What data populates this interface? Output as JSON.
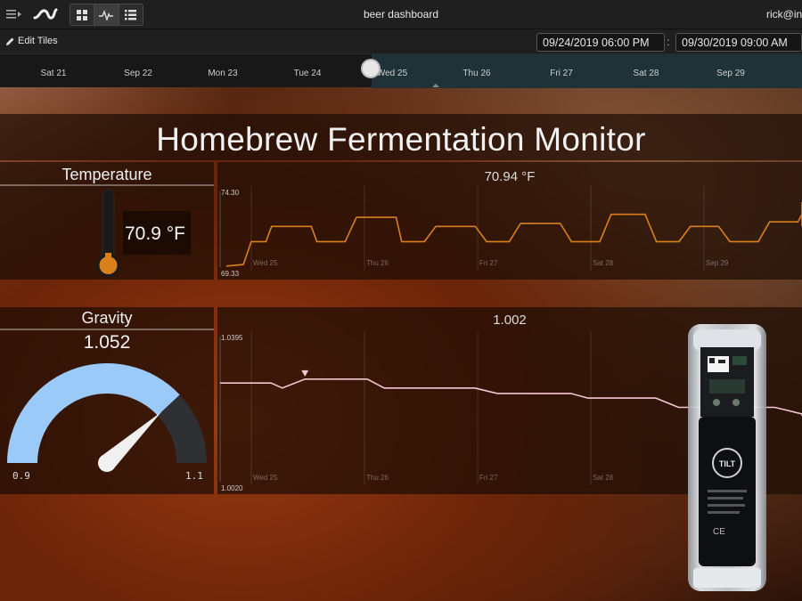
{
  "topbar": {
    "title": "beer dashboard",
    "user": "rick@ini",
    "menu_icon": "hamburger-expand-icon",
    "logo_icon": "wave-logo-icon",
    "view_buttons": [
      {
        "name": "grid-view-icon",
        "active": false
      },
      {
        "name": "pulse-view-icon",
        "active": true
      },
      {
        "name": "list-view-icon",
        "active": false
      }
    ]
  },
  "toolbar": {
    "edit_tiles": "Edit Tiles",
    "start_date": "09/24/2019 06:00 PM",
    "separator": ":",
    "end_date": "09/30/2019 09:00 AM"
  },
  "timeline": {
    "labels": [
      "Sat 21",
      "Sep 22",
      "Mon 23",
      "Tue 24",
      "Wed 25",
      "Thu 26",
      "Fri 27",
      "Sat 28",
      "Sep 29"
    ]
  },
  "dashboard": {
    "title": "Homebrew Fermentation Monitor"
  },
  "temperature": {
    "header": "Temperature",
    "value": "70.9 °F",
    "chart_value": "70.94 °F",
    "fill_fraction": 0.18,
    "color": "#d9801c"
  },
  "gravity": {
    "header": "Gravity",
    "value": "1.052",
    "gauge_min": "0.9",
    "gauge_max": "1.1",
    "gauge_fraction": 0.76,
    "chart_value": "1.002",
    "color": "#f4c6d4"
  },
  "chart_data": [
    {
      "type": "line",
      "ylim": [
        69.33,
        74.3
      ],
      "ytick_labels": [
        "74.30",
        "69.33"
      ],
      "xtick_labels": [
        "Wed 25",
        "Thu 26",
        "Fri 27",
        "Sat 28",
        "Sep 29"
      ],
      "x_days": [
        0,
        0.15,
        0.22,
        0.35,
        0.4,
        0.75,
        0.8,
        1.05,
        1.15,
        1.5,
        1.55,
        1.75,
        1.85,
        2.2,
        2.3,
        2.5,
        2.6,
        2.95,
        3.05,
        3.3,
        3.4,
        3.7,
        3.8,
        4.0,
        4.1,
        4.35,
        4.45,
        4.7,
        4.8,
        5.05,
        5.15,
        5.55,
        5.62,
        5.7,
        5.8,
        6.1
      ],
      "values": [
        69.4,
        69.5,
        71.0,
        71.0,
        72.0,
        72.0,
        71.0,
        71.0,
        72.6,
        72.6,
        71.0,
        71.0,
        72.0,
        72.0,
        71.0,
        71.0,
        72.2,
        72.2,
        71.0,
        71.0,
        72.8,
        72.8,
        71.0,
        71.0,
        72.0,
        72.0,
        71.0,
        71.0,
        72.3,
        72.3,
        72.8,
        72.8,
        73.6,
        72.9,
        72.0,
        72.0
      ]
    },
    {
      "type": "line",
      "ylim": [
        1.002,
        1.0395
      ],
      "ytick_labels": [
        "1.0395",
        "1.0020"
      ],
      "xtick_labels": [
        "Wed 25",
        "Thu 26",
        "Fri 27",
        "Sat 28"
      ],
      "x_days": [
        0,
        0.45,
        0.55,
        0.75,
        1.3,
        1.45,
        2.25,
        2.45,
        3.1,
        3.25,
        3.85,
        4.05,
        4.9,
        5.2,
        6.1
      ],
      "values": [
        1.0275,
        1.0275,
        1.0262,
        1.0285,
        1.0285,
        1.0262,
        1.0262,
        1.0248,
        1.0248,
        1.0236,
        1.0236,
        1.0212,
        1.0212,
        1.0195,
        1.019
      ]
    }
  ]
}
